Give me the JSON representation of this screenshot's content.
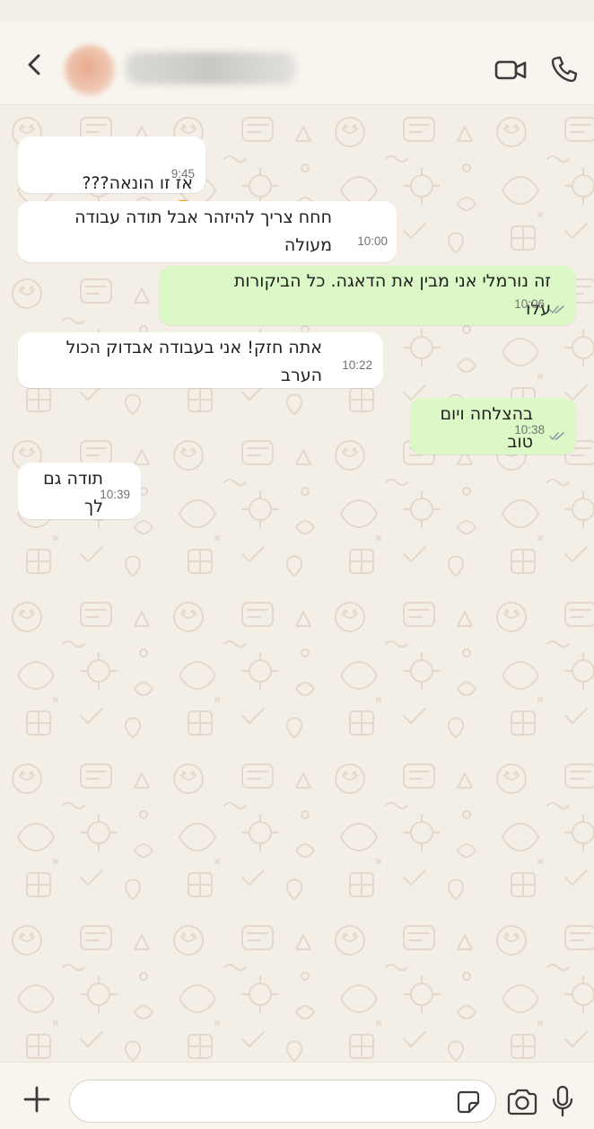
{
  "header": {
    "contact_name": "█████████",
    "icons": {
      "back": "chevron-left-icon",
      "video": "video-call-icon",
      "call": "phone-icon"
    }
  },
  "messages": [
    {
      "direction": "incoming",
      "text": "אז זו הונאה???",
      "emoji": "smiling-face-icon",
      "time": "9:45"
    },
    {
      "direction": "incoming",
      "text": "חחח צריך להיזהר אבל תודה עבודה\nמעולה",
      "time": "10:00"
    },
    {
      "direction": "outgoing",
      "text": "זה נורמלי אני מבין את הדאגה. כל הביקורות\nעלו",
      "time": "10:06"
    },
    {
      "direction": "incoming",
      "text": "אתה חזק! אני בעבודה אבדוק הכול\nהערב",
      "time": "10:22"
    },
    {
      "direction": "outgoing",
      "text": "בהצלחה ויום\nטוב",
      "time": "10:38"
    },
    {
      "direction": "incoming",
      "text": "תודה גם\nלך",
      "time": "10:39"
    }
  ],
  "composer": {
    "placeholder": "",
    "value": "",
    "icons": {
      "plus": "plus-icon",
      "sticker": "sticker-icon",
      "camera": "camera-icon",
      "mic": "microphone-icon"
    }
  },
  "colors": {
    "incoming_bubble": "#ffffff",
    "outgoing_bubble": "#dbf8c6",
    "chat_background": "#f4efe6",
    "read_ticks": "#8a9aa6"
  }
}
